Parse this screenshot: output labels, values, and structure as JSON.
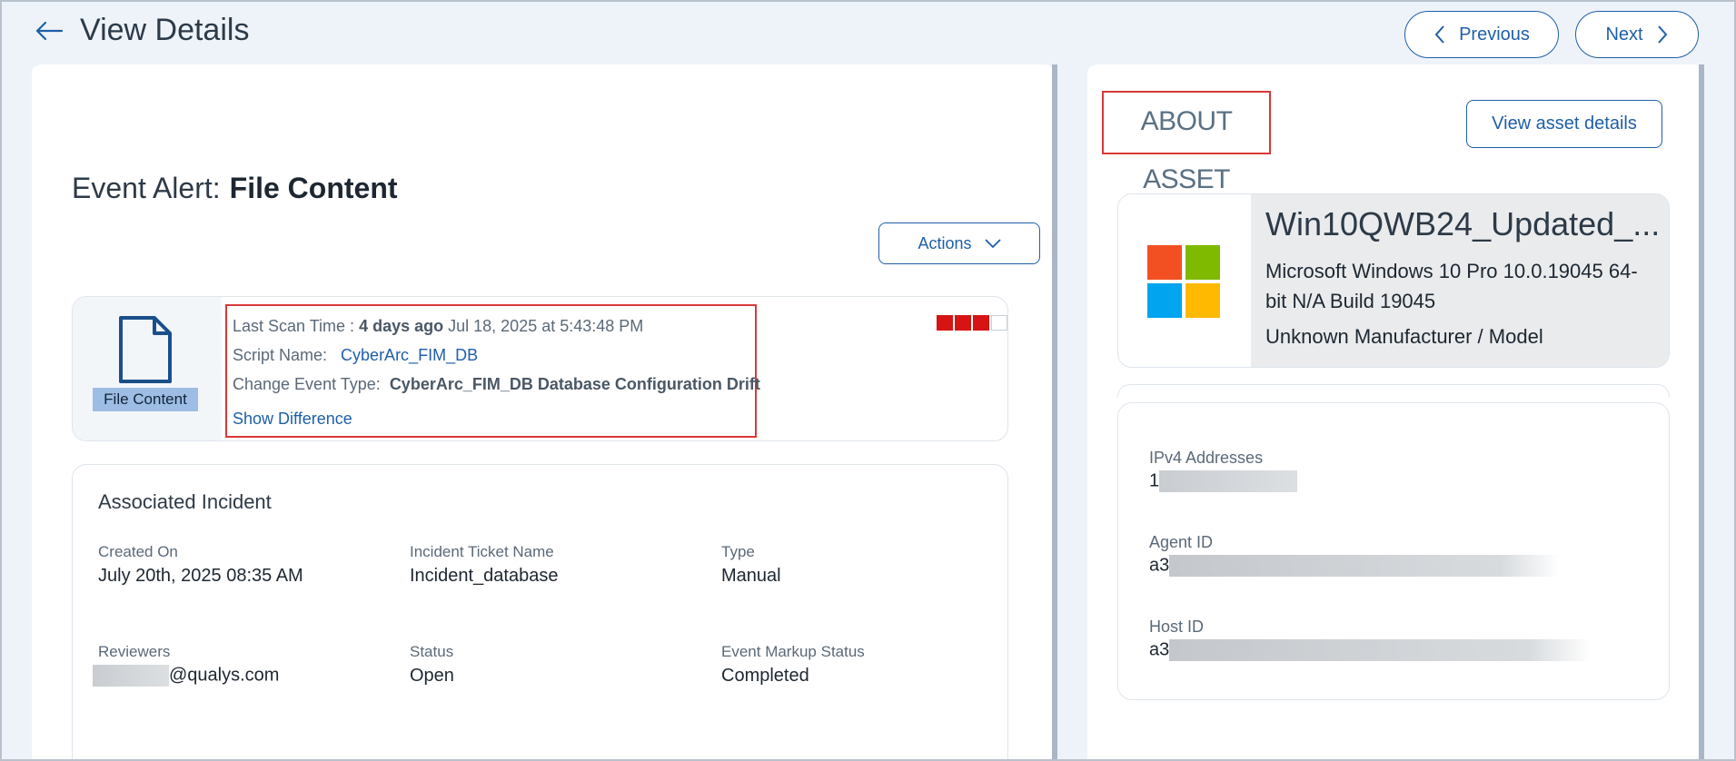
{
  "header": {
    "title": "View Details",
    "prev_label": "Previous",
    "next_label": "Next"
  },
  "event": {
    "prefix": "Event Alert:",
    "name": "File Content",
    "actions_label": "Actions",
    "badge": "File Content",
    "last_scan_label": "Last Scan Time :",
    "last_scan_relative": "4 days ago",
    "last_scan_date": "Jul 18, 2025 at 5:43:48 PM",
    "script_label": "Script Name:",
    "script_value": "CyberArc_FIM_DB",
    "change_label": "Change Event Type:",
    "change_value": "CyberArc_FIM_DB Database Configuration Drift",
    "show_diff": "Show Difference",
    "severity_level": 3,
    "severity_max": 5,
    "severity_color": "#d61414"
  },
  "incident": {
    "title": "Associated Incident",
    "fields": {
      "created_label": "Created On",
      "created_value": "July 20th, 2025 08:35 AM",
      "ticket_label": "Incident Ticket Name",
      "ticket_value": "Incident_database",
      "type_label": "Type",
      "type_value": "Manual",
      "reviewers_label": "Reviewers",
      "reviewers_value": "@qualys.com",
      "status_label": "Status",
      "status_value": "Open",
      "markup_label": "Event Markup Status",
      "markup_value": "Completed"
    }
  },
  "asset": {
    "section_title": "ABOUT ASSET",
    "view_btn": "View asset details",
    "name": "Win10QWB24_Updated_...",
    "os": "Microsoft Windows 10 Pro 10.0.19045 64-bit N/A Build 19045",
    "manufacturer": "Unknown Manufacturer / Model",
    "ipv4_label": "IPv4 Addresses",
    "ipv4_value": "1",
    "agent_label": "Agent ID",
    "agent_value": "a3",
    "host_label": "Host ID",
    "host_value": "a3"
  },
  "colors": {
    "accent": "#1f5fa8",
    "highlight_border": "#d93838"
  }
}
